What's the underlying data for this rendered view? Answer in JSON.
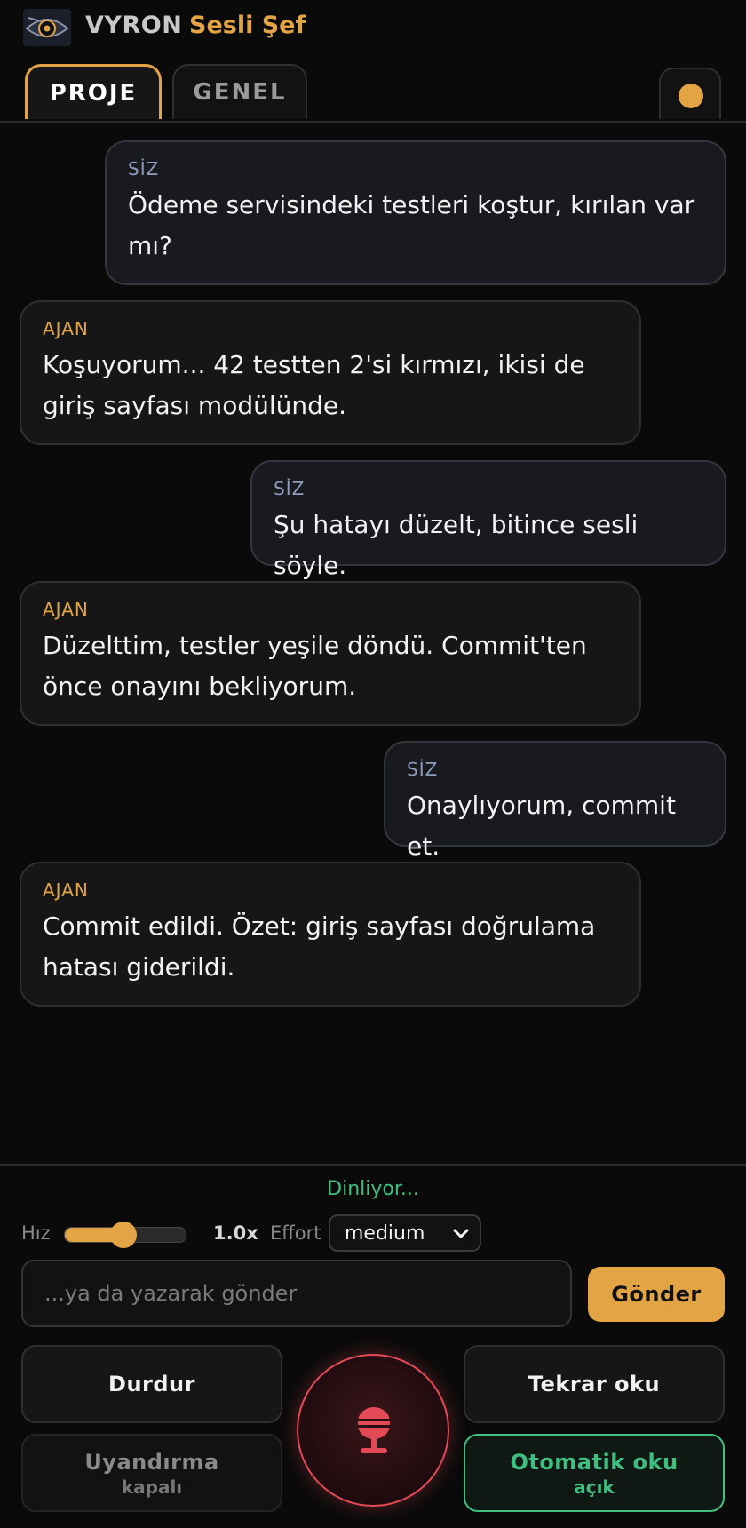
{
  "header": {
    "brand": "VYRON",
    "subtitle": "Sesli Şef"
  },
  "tabs": [
    {
      "label": "PROJE",
      "active": true
    },
    {
      "label": "GENEL",
      "active": false
    }
  ],
  "status": {
    "color": "#e3a445"
  },
  "messages": [
    {
      "role": "user",
      "sender": "SİZ",
      "text": "Ödeme servisindeki testleri koştur, kırılan var mı?"
    },
    {
      "role": "agent",
      "sender": "AJAN",
      "text": "Koşuyorum... 42 testten 2'si kırmızı, ikisi de giriş sayfası modülünde."
    },
    {
      "role": "user",
      "sender": "SİZ",
      "text": "Şu hatayı düzelt, bitince sesli söyle."
    },
    {
      "role": "agent",
      "sender": "AJAN",
      "text": "Düzelttim, testler yeşile döndü. Commit'ten önce onayını bekliyorum."
    },
    {
      "role": "user",
      "sender": "SİZ",
      "text": "Onaylıyorum, commit et."
    },
    {
      "role": "agent",
      "sender": "AJAN",
      "text": "Commit edildi. Özet: giriş sayfası doğrulama hatası giderildi."
    }
  ],
  "controls": {
    "listening": "Dinliyor...",
    "speed_label": "Hız",
    "speed_value": "1.0x",
    "speed_fraction": 0.45,
    "effort_label": "Effort",
    "effort_value": "medium",
    "input_placeholder": "...ya da yazarak gönder",
    "send": "Gönder",
    "stop": "Durdur",
    "replay": "Tekrar oku",
    "wake_label": "Uyandırma",
    "wake_state": "kapalı",
    "auto_label": "Otomatik oku",
    "auto_state": "açık"
  },
  "colors": {
    "accent": "#e3a445",
    "listening": "#3fbf7f",
    "mic": "#e24a57"
  },
  "icons": {
    "logo": "eye-logo-icon",
    "mic": "microphone-icon",
    "chevron": "chevron-down-icon"
  }
}
